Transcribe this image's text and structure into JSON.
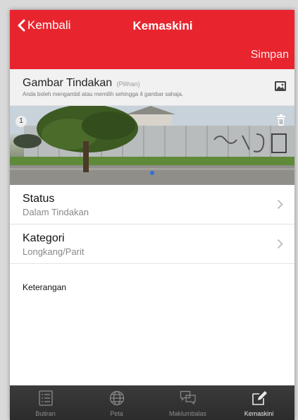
{
  "nav": {
    "back_label": "Kembali",
    "title": "Kemaskini",
    "save_label": "Simpan"
  },
  "photos": {
    "title": "Gambar Tindakan",
    "optional": "(Pilihan)",
    "help": "Anda boleh mengambil atau memilih sehingga 4 gambar sahaja.",
    "count": "1"
  },
  "fields": [
    {
      "label": "Status",
      "value": "Dalam Tindakan"
    },
    {
      "label": "Kategori",
      "value": "Longkang/Parit"
    }
  ],
  "notes": {
    "label": "Keterangan"
  },
  "tabs": [
    {
      "label": "Butiran",
      "icon": "list-icon"
    },
    {
      "label": "Peta",
      "icon": "globe-icon"
    },
    {
      "label": "Maklumbalas",
      "icon": "chat-bubbles-icon"
    },
    {
      "label": "Kemaskini",
      "icon": "edit-icon",
      "active": true
    }
  ],
  "colors": {
    "accent": "#e8252e",
    "tabbar": "#2f2f2f",
    "page_indicator": "#2f6fe0"
  }
}
